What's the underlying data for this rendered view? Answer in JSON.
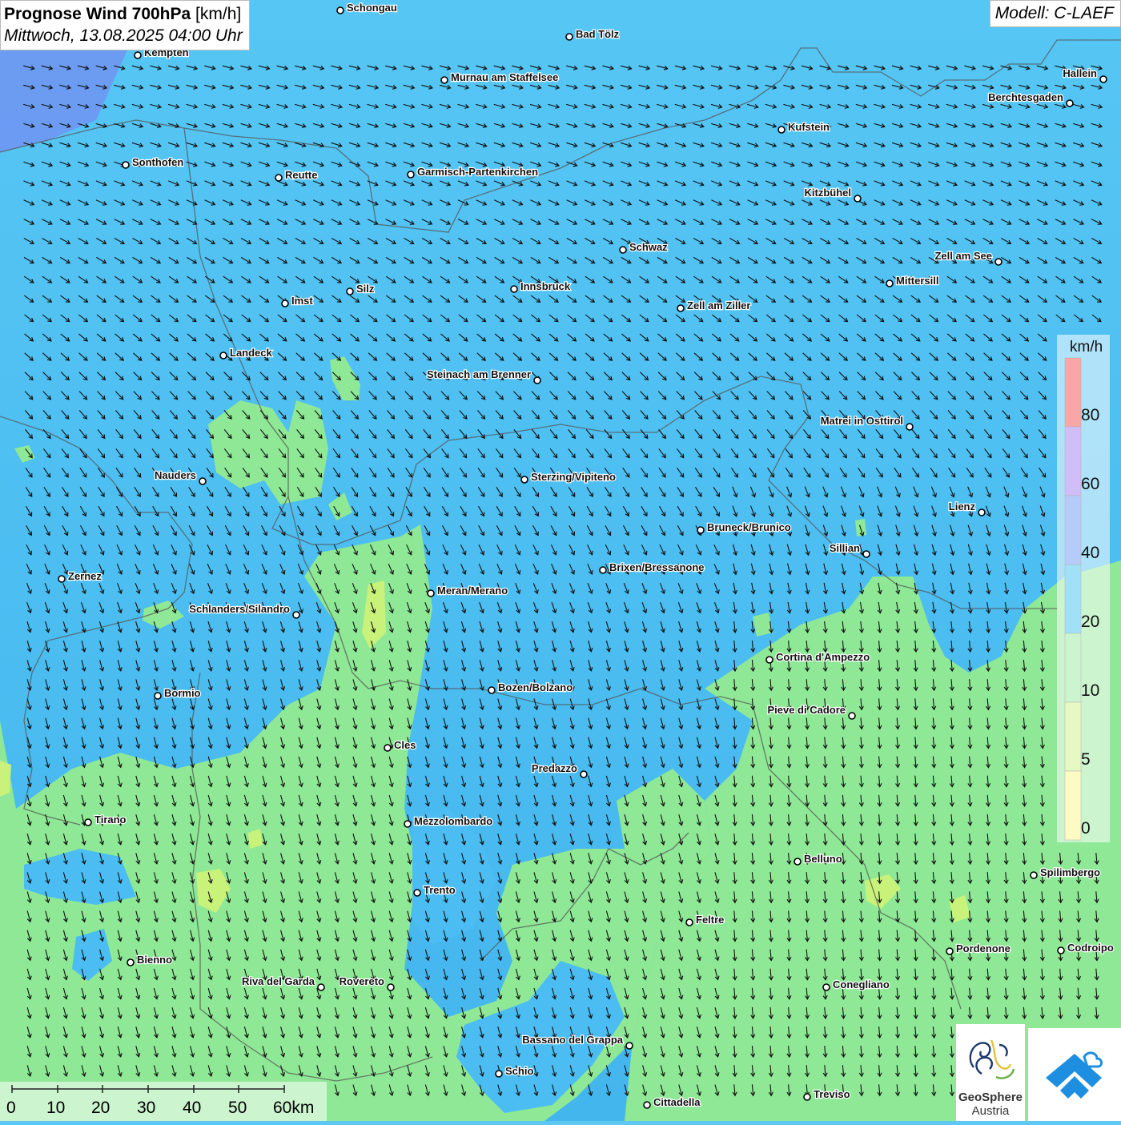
{
  "title": {
    "bold": "Prognose Wind 700hPa",
    "unit": "[km/h]",
    "datetime": "Mittwoch, 13.08.2025 04:00 Uhr"
  },
  "model": "Modell: C-LAEF",
  "legend": {
    "unit": "km/h",
    "labels": [
      "80",
      "60",
      "40",
      "20",
      "10",
      "5",
      "0"
    ],
    "colors": {
      "80": "#f23b3b",
      "60": "#9a6ef0",
      "40": "#5b8ff5",
      "20": "#2fbdf0",
      "10": "#8ee895",
      "5": "#c8f27a",
      "0": "#f5f57a"
    }
  },
  "scale_bar": {
    "labels": [
      "0",
      "10",
      "20",
      "30",
      "40",
      "50",
      "60km"
    ]
  },
  "logo": {
    "org_line1": "GeoSphere",
    "org_line2": "Austria"
  },
  "cities": [
    {
      "name": "Schongau",
      "label": "right"
    },
    {
      "name": "Bad Tölz",
      "label": "right"
    },
    {
      "name": "Kempten",
      "label": "right"
    },
    {
      "name": "Murnau am Staffelsee",
      "label": "right"
    },
    {
      "name": "Hallein",
      "label": "left"
    },
    {
      "name": "Berchtesgaden",
      "label": "left"
    },
    {
      "name": "Kufstein",
      "label": "right"
    },
    {
      "name": "Sonthofen",
      "label": "right"
    },
    {
      "name": "Reutte",
      "label": "right"
    },
    {
      "name": "Garmisch-Partenkirchen",
      "label": "right"
    },
    {
      "name": "Kitzbühel",
      "label": "left"
    },
    {
      "name": "Schwaz",
      "label": "right"
    },
    {
      "name": "Zell am See",
      "label": "left"
    },
    {
      "name": "Innsbruck",
      "label": "right"
    },
    {
      "name": "Mittersill",
      "label": "right"
    },
    {
      "name": "Silz",
      "label": "right"
    },
    {
      "name": "Imst",
      "label": "right"
    },
    {
      "name": "Zell am Ziller",
      "label": "right"
    },
    {
      "name": "Landeck",
      "label": "right"
    },
    {
      "name": "Steinach am Brenner",
      "label": "left"
    },
    {
      "name": "Matrei in Osttirol",
      "label": "left"
    },
    {
      "name": "Nauders",
      "label": "left"
    },
    {
      "name": "Sterzing/Vipiteno",
      "label": "right"
    },
    {
      "name": "Lienz",
      "label": "left"
    },
    {
      "name": "Bruneck/Brunico",
      "label": "right"
    },
    {
      "name": "Sillian",
      "label": "left"
    },
    {
      "name": "Zernez",
      "label": "right"
    },
    {
      "name": "Brixen/Bressanone",
      "label": "right"
    },
    {
      "name": "Meran/Merano",
      "label": "right"
    },
    {
      "name": "Schlanders/Silandro",
      "label": "left"
    },
    {
      "name": "Cortina d'Ampezzo",
      "label": "right"
    },
    {
      "name": "Bozen/Bolzano",
      "label": "right"
    },
    {
      "name": "Bormio",
      "label": "right"
    },
    {
      "name": "Pieve di Cadore",
      "label": "left"
    },
    {
      "name": "Cles",
      "label": "right"
    },
    {
      "name": "Predazzo",
      "label": "left"
    },
    {
      "name": "Tirano",
      "label": "right"
    },
    {
      "name": "Mezzolombardo",
      "label": "right"
    },
    {
      "name": "Belluno",
      "label": "right"
    },
    {
      "name": "Spilimbergo",
      "label": "right"
    },
    {
      "name": "Trento",
      "label": "right"
    },
    {
      "name": "Feltre",
      "label": "right"
    },
    {
      "name": "Pordenone",
      "label": "right"
    },
    {
      "name": "Codroipo",
      "label": "right"
    },
    {
      "name": "Bienno",
      "label": "right"
    },
    {
      "name": "Riva del Garda",
      "label": "left"
    },
    {
      "name": "Rovereto",
      "label": "left"
    },
    {
      "name": "Conegliano",
      "label": "right"
    },
    {
      "name": "Bassano del Grappa",
      "label": "left"
    },
    {
      "name": "Schio",
      "label": "right"
    },
    {
      "name": "Treviso",
      "label": "right"
    },
    {
      "name": "Cittadella",
      "label": "right"
    }
  ]
}
